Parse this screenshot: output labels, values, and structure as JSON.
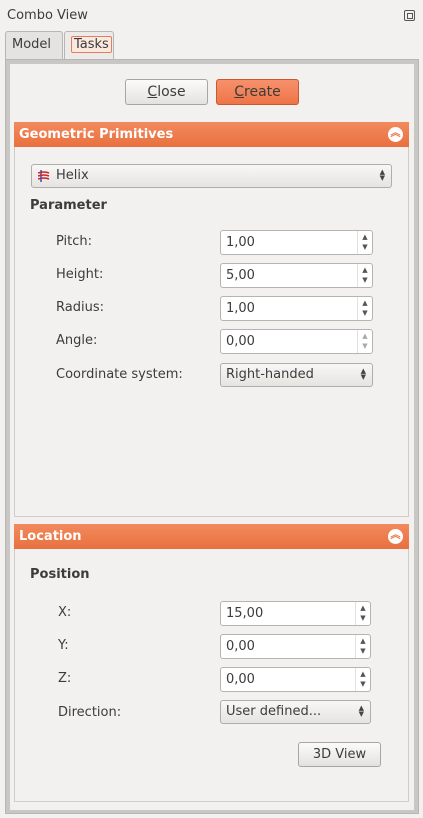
{
  "window": {
    "title": "Combo View"
  },
  "tabs": [
    {
      "label": "Model"
    },
    {
      "label": "Tasks"
    }
  ],
  "actions": {
    "close_mnemonic": "C",
    "close_rest": "lose",
    "create_mnemonic": "C",
    "create_rest": "reate"
  },
  "primitives": {
    "header": "Geometric Primitives",
    "selected_type": "Helix",
    "group": "Parameter",
    "fields": [
      {
        "label": "Pitch:",
        "value": "1,00"
      },
      {
        "label": "Height:",
        "value": "5,00"
      },
      {
        "label": "Radius:",
        "value": "1,00"
      },
      {
        "label": "Angle:",
        "value": "0,00"
      }
    ],
    "coordinate_system": {
      "label": "Coordinate system:",
      "value": "Right-handed"
    }
  },
  "location": {
    "header": "Location",
    "group": "Position",
    "fields": [
      {
        "label": "X:",
        "value": "15,00"
      },
      {
        "label": "Y:",
        "value": "0,00"
      },
      {
        "label": "Z:",
        "value": "0,00"
      }
    ],
    "direction": {
      "label": "Direction:",
      "value": "User defined..."
    },
    "view_button": "3D View"
  },
  "colors": {
    "accent": "#ef7448",
    "panel_bg": "#f2f1f0"
  }
}
